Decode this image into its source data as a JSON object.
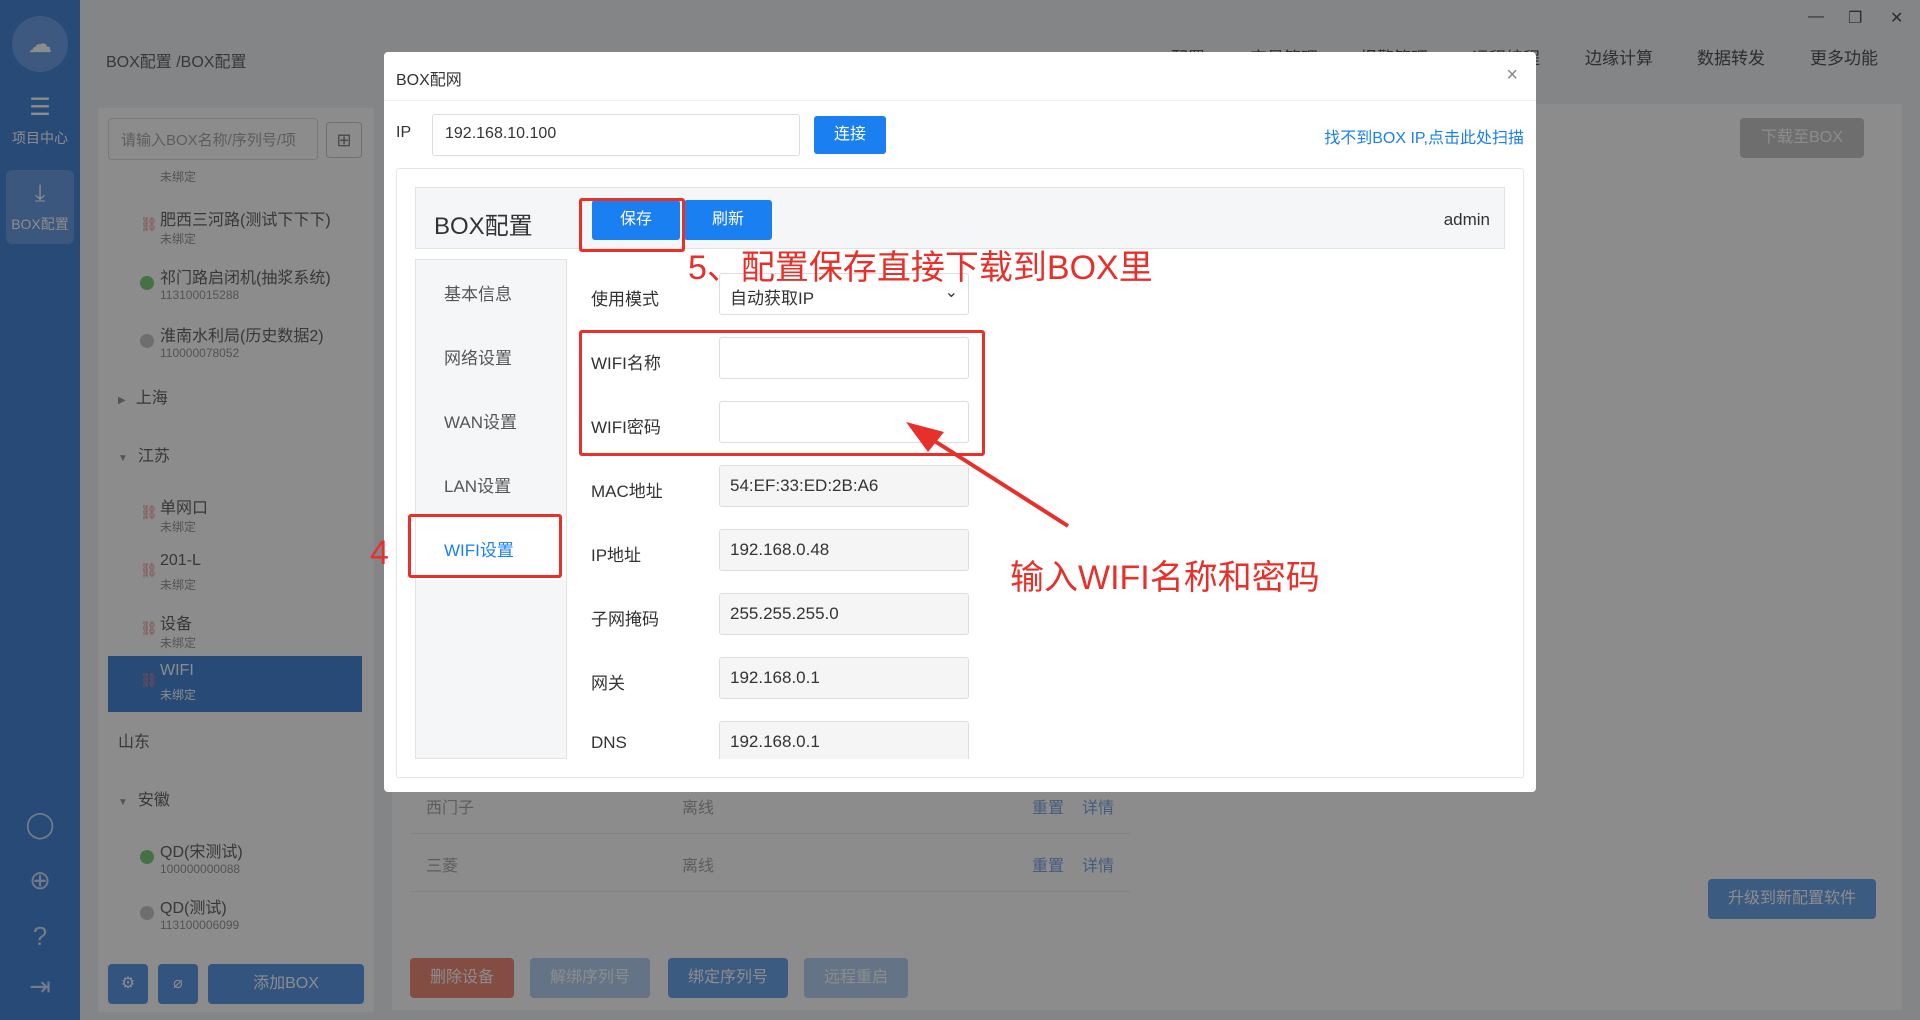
{
  "rail": {
    "items": [
      {
        "label": "项目中心",
        "icon": "grid-icon"
      },
      {
        "label": "BOX配置",
        "icon": "download-icon"
      }
    ]
  },
  "header": {
    "breadcrumb": "BOX配置 /BOX配置",
    "nav": [
      "BOX配置",
      "变量管理",
      "报警管理",
      "远程编程",
      "边缘计算",
      "数据转发",
      "更多功能"
    ]
  },
  "side": {
    "search_placeholder": "请输入BOX名称/序列号/项",
    "devices_top": [
      {
        "name": "",
        "sub": "未绑定",
        "status": "unbound"
      },
      {
        "name": "肥西三河路(测试下下下)",
        "sub": "未绑定",
        "status": "unbound"
      },
      {
        "name": "祁门路启闭机(抽浆系统)",
        "sub": "113100015288",
        "status": "online"
      },
      {
        "name": "淮南水利局(历史数据2)",
        "sub": "110000078052",
        "status": "offline"
      }
    ],
    "groups": [
      "上海",
      "江苏",
      "山东",
      "安徽"
    ],
    "devices_js": [
      {
        "name": "单网口",
        "sub": "未绑定"
      },
      {
        "name": "201-L",
        "sub": "未绑定"
      },
      {
        "name": "设备",
        "sub": "未绑定"
      },
      {
        "name": "WIFI",
        "sub": "未绑定"
      }
    ],
    "devices_ah": [
      {
        "name": "QD(宋测试)",
        "sub": "100000000088",
        "status": "online"
      },
      {
        "name": "QD(测试)",
        "sub": "113100006099",
        "status": "offline"
      }
    ],
    "add_box": "添加BOX"
  },
  "main": {
    "download_btn": "下载至BOX",
    "upgrade_btn": "升级到新配置软件",
    "rows": [
      {
        "name": "西门子",
        "status": "离线",
        "op1": "重置",
        "op2": "详情"
      },
      {
        "name": "三菱",
        "status": "离线",
        "op1": "重置",
        "op2": "详情"
      }
    ],
    "bottom_buttons": [
      "删除设备",
      "解绑序列号",
      "绑定序列号",
      "远程重启"
    ]
  },
  "modal": {
    "title": "BOX配网",
    "ip_label": "IP",
    "ip_value": "192.168.10.100",
    "connect": "连接",
    "scan_link": "找不到BOX IP,点击此处扫描",
    "cfg_title": "BOX配置",
    "save": "保存",
    "refresh": "刷新",
    "user": "admin",
    "tabs": [
      "基本信息",
      "网络设置",
      "WAN设置",
      "LAN设置",
      "WIFI设置"
    ],
    "fields": [
      {
        "label": "使用模式",
        "value": "自动获取IP"
      },
      {
        "label": "WIFI名称",
        "value": ""
      },
      {
        "label": "WIFI密码",
        "value": ""
      },
      {
        "label": "MAC地址",
        "value": "54:EF:33:ED:2B:A6"
      },
      {
        "label": "IP地址",
        "value": "192.168.0.48"
      },
      {
        "label": "子网掩码",
        "value": "255.255.255.0"
      },
      {
        "label": "网关",
        "value": "192.168.0.1"
      },
      {
        "label": "DNS",
        "value": "192.168.0.1"
      }
    ]
  },
  "annotations": {
    "step4": "4",
    "step5": "5、配置保存直接下载到BOX里",
    "wifi_hint": "输入WIFI名称和密码",
    "color": "#e8302a"
  }
}
